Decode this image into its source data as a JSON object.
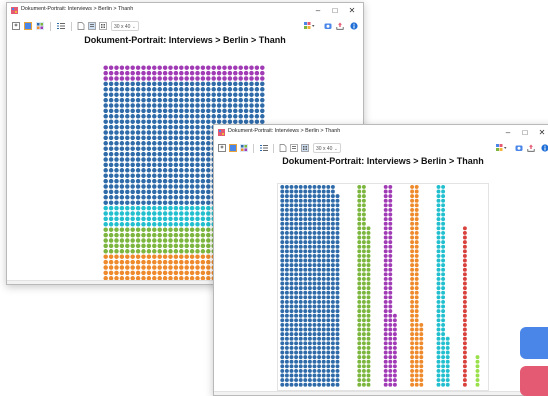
{
  "window_back": {
    "title": "Dokument-Portrait: Interviews > Berlin > Thanh",
    "doc_title": "Dokument-Portrait: Interviews > Berlin > Thanh",
    "grid_option": "30 x 40"
  },
  "window_front": {
    "title": "Dokument-Portrait: Interviews > Berlin > Thanh",
    "doc_title": "Dokument-Portrait: Interviews > Berlin > Thanh",
    "grid_option": "30 x 40"
  },
  "window_buttons": {
    "minimize": "–",
    "maximize": "□",
    "close": "✕"
  },
  "colors": {
    "purple": "#a13bb5",
    "blue": "#2f6ba9",
    "cyan": "#22bfcf",
    "green": "#7cb63e",
    "orange": "#ee8a2c",
    "red": "#d8413c",
    "lime": "#9ae04a",
    "accent_blue": "#4a86e8",
    "accent_pink": "#e55a73"
  },
  "portrait_rows": [
    {
      "color": "purple",
      "count": 3
    },
    {
      "color": "blue",
      "count": 23
    },
    {
      "color": "cyan",
      "count": 4
    },
    {
      "color": "green",
      "count": 5
    },
    {
      "color": "orange",
      "count": 5
    }
  ],
  "columns_view": [
    {
      "color": "blue",
      "count": 570
    },
    {
      "color": "green",
      "count": 123
    },
    {
      "color": "purple",
      "count": 104
    },
    {
      "color": "orange",
      "count": 102
    },
    {
      "color": "cyan",
      "count": 99
    },
    {
      "color": "red",
      "count": 35
    },
    {
      "color": "lime",
      "count": 7
    }
  ]
}
